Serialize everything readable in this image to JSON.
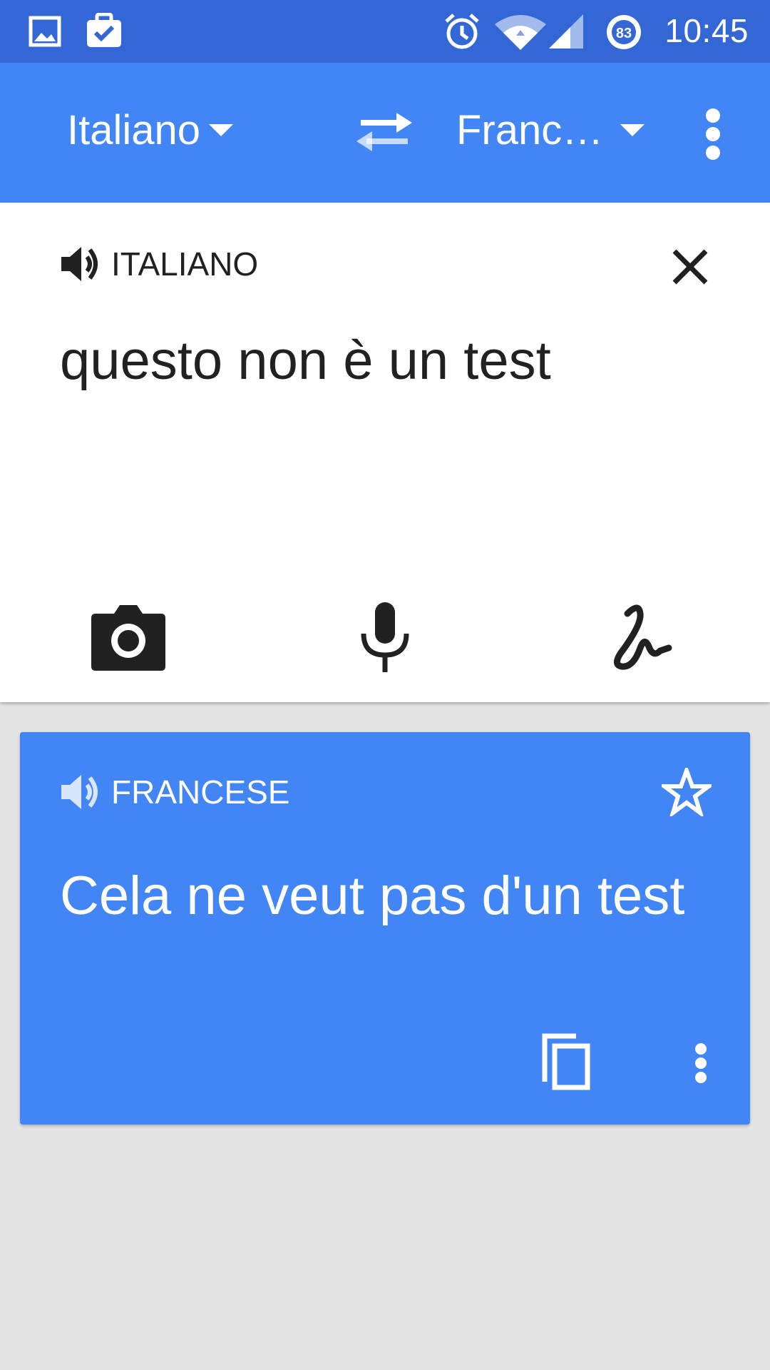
{
  "status_bar": {
    "time": "10:45",
    "battery_level": "83",
    "icons": [
      "image-icon",
      "clipboard-check-icon",
      "alarm-icon",
      "wifi-icon",
      "signal-icon",
      "battery-icon"
    ]
  },
  "toolbar": {
    "source_language": "Italiano",
    "target_language": "Franc…",
    "icons": [
      "swap-languages-icon",
      "more-vert-icon"
    ]
  },
  "input_card": {
    "language_label": "ITALIANO",
    "text": "questo non è un test",
    "tools": [
      "camera-icon",
      "microphone-icon",
      "handwriting-icon"
    ]
  },
  "result_card": {
    "language_label": "FRANCESE",
    "text": "Cela ne veut pas d'un test",
    "icons": [
      "star-icon",
      "copy-icon",
      "more-vert-icon"
    ]
  },
  "colors": {
    "status_bar": "#3367d6",
    "toolbar": "#4285f4",
    "result_card": "#4285f4",
    "background": "#e5e5e5",
    "input_card": "#ffffff"
  }
}
